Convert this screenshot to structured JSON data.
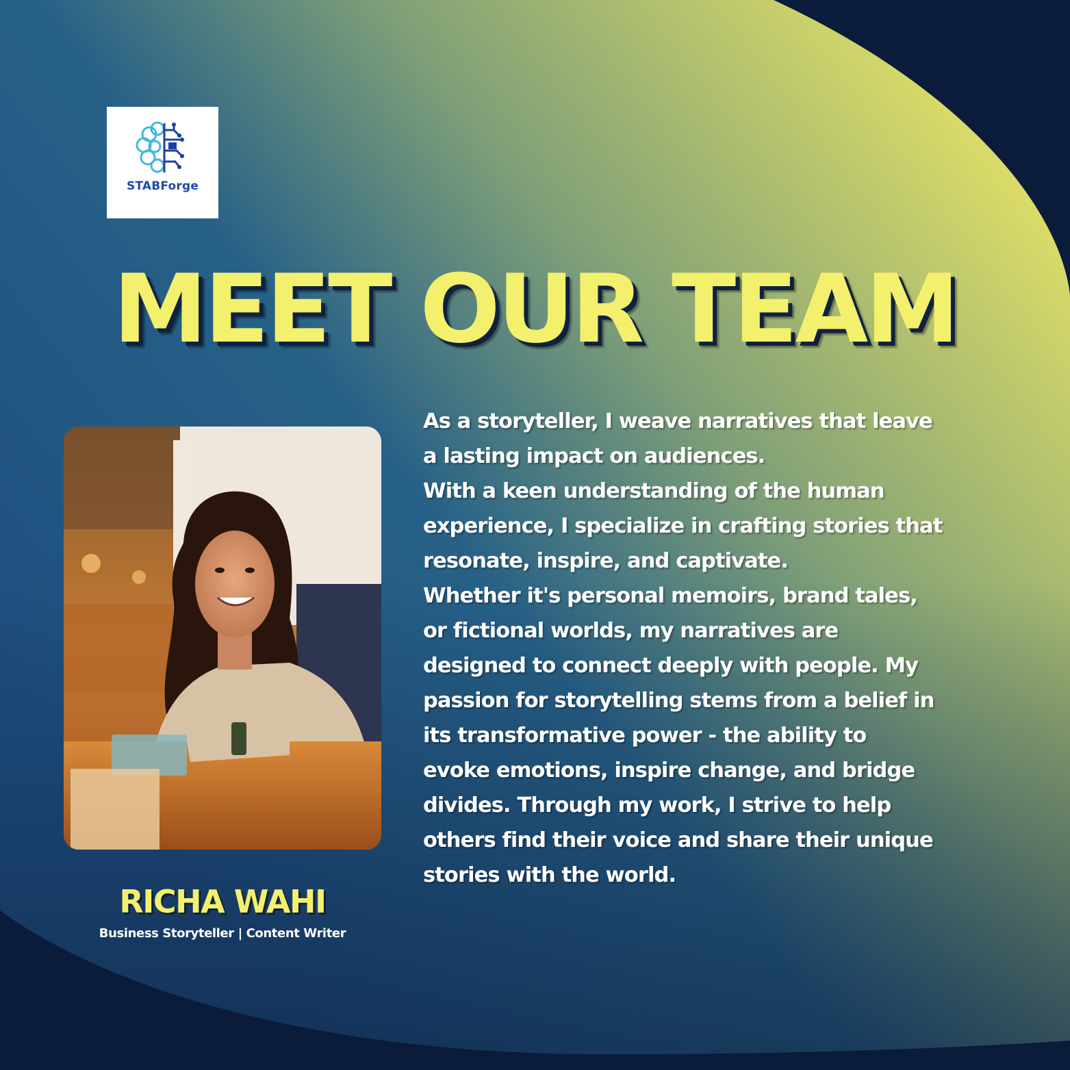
{
  "brand": {
    "name": "STABForge",
    "logo_icon": "brain-circuit-icon"
  },
  "headline": "MEET OUR TEAM",
  "member": {
    "name": "RICHA WAHI",
    "role": "Business Storyteller | Content Writer",
    "photo": "portrait-photo"
  },
  "bio_lines": [
    "As a storyteller, I weave narratives that leave",
    "a lasting impact on audiences.",
    "With a keen understanding of the human",
    "experience, I specialize in crafting stories that",
    "resonate, inspire, and captivate.",
    "Whether it's personal memoirs, brand tales,",
    "or fictional worlds, my narratives are",
    "designed to connect deeply with people. My",
    "passion for storytelling stems from a belief in",
    "its transformative power - the ability to",
    "evoke emotions, inspire change, and bridge",
    "divides. Through my work, I strive to help",
    "others find their voice and share their unique",
    "stories with the world."
  ],
  "colors": {
    "background_dark": "#0b1b3a",
    "accent_yellow": "#f3f06e",
    "text_white": "#ffffff",
    "logo_blue": "#1f4aa8"
  }
}
